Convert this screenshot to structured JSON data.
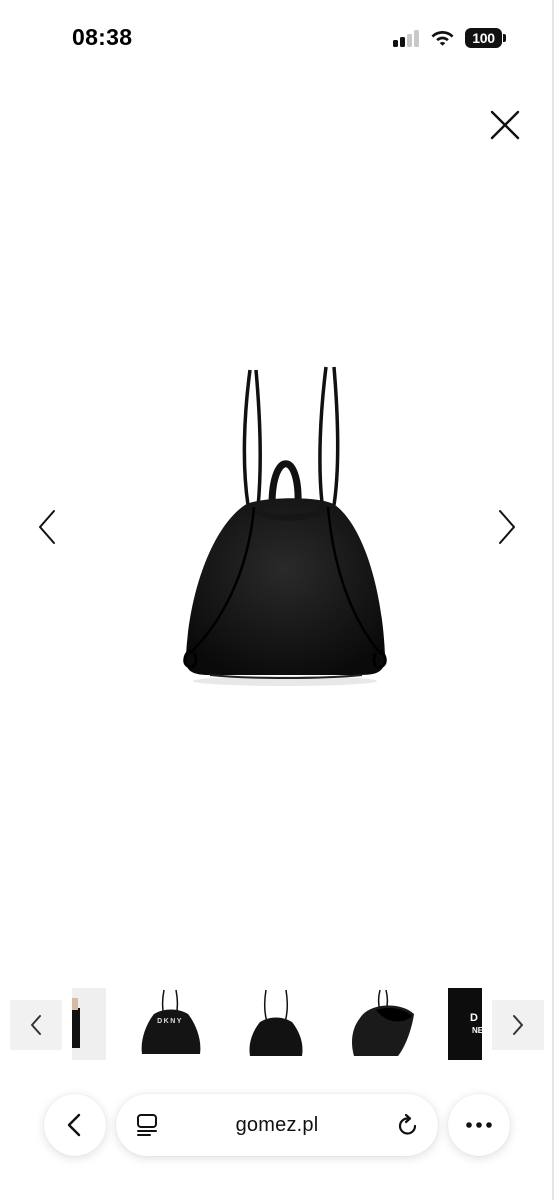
{
  "status_bar": {
    "time": "08:38",
    "battery": "100"
  },
  "gallery": {
    "close_icon": "close-icon",
    "prev_icon": "chevron-left-icon",
    "next_icon": "chevron-right-icon",
    "main_image_alt": "black drawstring backpack"
  },
  "thumbnails": {
    "prev_icon": "chevron-left-icon",
    "next_icon": "chevron-right-icon",
    "thumb_brand_text": "DKNY",
    "thumb_partial_text": "D",
    "thumb_partial_text2": "NE"
  },
  "browser": {
    "url": "gomez.pl",
    "back_icon": "chevron-left-icon",
    "reader_icon": "reader-icon",
    "reload_icon": "reload-icon",
    "more_icon": "more-icon"
  }
}
